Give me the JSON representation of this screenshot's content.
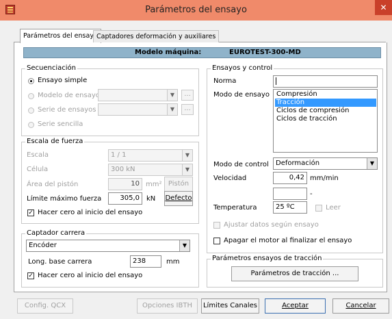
{
  "window": {
    "title": "Parámetros del ensayo",
    "close_glyph": "✕"
  },
  "tabs": [
    {
      "label": "Parámetros del ensayo",
      "active": true
    },
    {
      "label": "Captadores deformación y auxiliares",
      "active": false
    }
  ],
  "banner": {
    "label": "Modelo máquina:",
    "value": "EUROTEST-300-MD"
  },
  "secuenciacion": {
    "legend": "Secuenciación",
    "ensayo_simple": "Ensayo simple",
    "modelo_ensayo": "Modelo de ensayo",
    "serie_ensayos": "Serie de ensayos",
    "serie_sencilla": "Serie sencilla",
    "ellipsis": "..."
  },
  "escala_fuerza": {
    "legend": "Escala de fuerza",
    "escala_label": "Escala",
    "escala_value": "1 / 1",
    "celula_label": "Célula",
    "celula_value": "300 kN",
    "area_label": "Área del pistón",
    "area_value": "10",
    "area_unit": "mm²",
    "piston_button": "Pistón",
    "limite_label": "Límite máximo fuerza",
    "limite_value": "305,0",
    "limite_unit": "kN",
    "defecto_button": "Defecto",
    "hacer_cero": "Hacer cero al inicio del ensayo"
  },
  "captador_carrera": {
    "legend": "Captador carrera",
    "encoder_value": "Encóder",
    "long_label": "Long. base carrera",
    "long_value": "238",
    "long_unit": "mm",
    "hacer_cero": "Hacer cero al inicio del ensayo"
  },
  "ensayos_control": {
    "legend": "Ensayos y control",
    "norma_label": "Norma",
    "norma_value": "",
    "modo_ensayo_label": "Modo de ensayo",
    "modo_ensayo_options": [
      "Compresión",
      "Tracción",
      "Ciclos de compresión",
      "Ciclos de tracción"
    ],
    "modo_ensayo_selected": 1,
    "modo_control_label": "Modo de control",
    "modo_control_value": "Deformación",
    "velocidad_label": "Velocidad",
    "velocidad_value": "0,42",
    "velocidad_unit": "mm/min",
    "extra_value": "",
    "extra_unit": "-",
    "temperatura_label": "Temperatura",
    "temperatura_value": "25 ºC",
    "leer_label": "Leer",
    "ajustar_label": "Ajustar datos según ensayo",
    "apagar_label": "Apagar el motor al finalizar el ensayo"
  },
  "traccion": {
    "legend": "Parámetros ensayos de tracción",
    "button": "Parámetros de tracción ..."
  },
  "footer": {
    "config_qcx": "Config. QCX",
    "opciones_ibth": "Opciones IBTH",
    "limites_canales": "Límites Canales",
    "aceptar": "Aceptar",
    "cancelar": "Cancelar"
  },
  "colors": {
    "titlebar": "#f08a6a",
    "close": "#c9402a",
    "banner": "#8fb3ca",
    "selection": "#3399ff"
  }
}
